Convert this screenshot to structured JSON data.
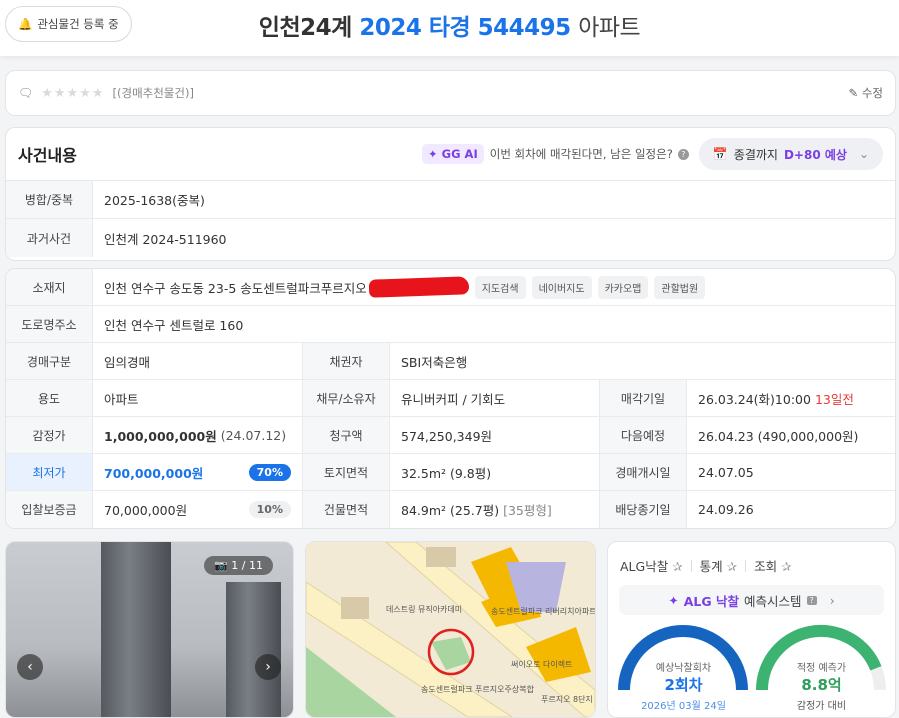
{
  "header": {
    "watch_label": "관심물건 등록 중",
    "title_court": "인천24계",
    "title_case": "2024 타경 544495",
    "title_type": "아파트"
  },
  "comment": {
    "rating": 0,
    "tag": "[(경매추천물건)]",
    "edit_label": "수정"
  },
  "case": {
    "title": "사건내용",
    "ai_badge": "GG AI",
    "ai_question": "이번 회차에 매각된다면, 남은 일정은?",
    "dropdown_prefix": "종결까지",
    "dropdown_value": "D+80 예상",
    "rows": [
      {
        "label": "병합/중복",
        "value": "2025-1638(중복)"
      },
      {
        "label": "과거사건",
        "value": "인천계 2024-511960"
      }
    ]
  },
  "info": {
    "address_label": "소재지",
    "address": "인천 연수구 송도동 23-5 송도센트럴파크푸르지오",
    "map_buttons": [
      "지도검색",
      "네이버지도",
      "카카오맵",
      "관할법원"
    ],
    "road_label": "도로명주소",
    "road": "인천 연수구 센트럴로 160",
    "auction_type_label": "경매구분",
    "auction_type": "임의경매",
    "creditor_label": "채권자",
    "creditor": "SBI저축은행",
    "use_label": "용도",
    "use": "아파트",
    "debtor_label": "채무/소유자",
    "debtor": "유니버커피 / 기회도",
    "sale_date_label": "매각기일",
    "sale_date": "26.03.24(화)10:00",
    "sale_dday": "13일전",
    "appraisal_label": "감정가",
    "appraisal": "1,000,000,000원",
    "appraisal_date": "(24.07.12)",
    "claim_label": "청구액",
    "claim": "574,250,349원",
    "next_label": "다음예정",
    "next": "26.04.23 (490,000,000원)",
    "min_label": "최저가",
    "min": "700,000,000원",
    "min_pct": "70%",
    "land_label": "토지면적",
    "land": "32.5m² (9.8평)",
    "start_label": "경매개시일",
    "start": "24.07.05",
    "deposit_label": "입찰보증금",
    "deposit": "70,000,000원",
    "deposit_pct": "10%",
    "bldg_label": "건물면적",
    "bldg": "84.9m² (25.7평)",
    "bldg_type": "[35평형]",
    "divid_label": "배당종기일",
    "divid": "24.09.26"
  },
  "photo": {
    "counter": "1 / 11"
  },
  "map": {
    "labels": [
      "데스트링 뮤직아카데미",
      "송도센트럴파크 리버리치아파트",
      "송도센트럴파크 푸르지오주상복합",
      "써이오토 다이렉트",
      "푸르지오 8단지"
    ]
  },
  "stats": {
    "tabs": [
      "ALG낙찰",
      "통계",
      "조회"
    ],
    "alg_brand": "ALG 낙찰",
    "alg_label": "예측시스템",
    "gauge1": {
      "label": "예상낙찰회차",
      "value": "2회차",
      "date": "2026년 03월 24일",
      "fill": 1.0
    },
    "gauge2": {
      "label": "적정 예측가",
      "value": "8.8억",
      "sub": "감정가 대비",
      "fill": 0.88
    },
    "colors": {
      "blue": "#1565c0",
      "green": "#3cb371"
    }
  }
}
